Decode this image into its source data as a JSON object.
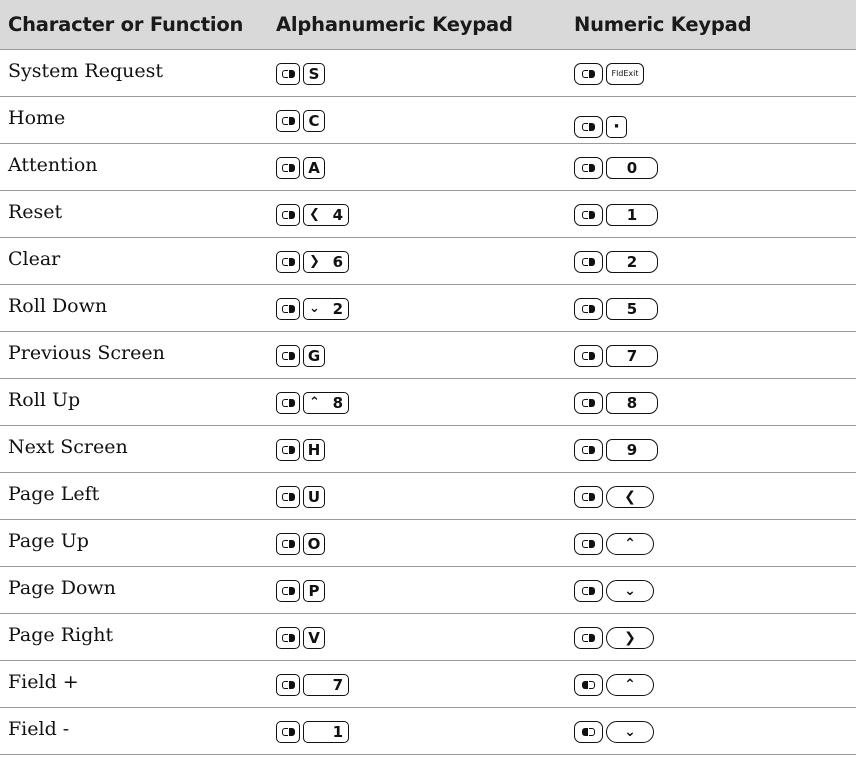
{
  "headers": [
    "Character or Function",
    "Alphanumeric Keypad",
    "Numeric Keypad"
  ],
  "icons": {
    "shift_key": "orange-shift-key-icon",
    "green_shift_key": "green-shift-key-icon"
  },
  "rows": [
    {
      "function": "System Request",
      "alpha": "S",
      "num": "FldExit"
    },
    {
      "function": "Home",
      "alpha": "C",
      "num": "·"
    },
    {
      "function": "Attention",
      "alpha": "A",
      "num": "0"
    },
    {
      "function": "Reset",
      "alpha": "4",
      "num": "1"
    },
    {
      "function": "Clear",
      "alpha": "6",
      "num": "2"
    },
    {
      "function": "Roll Down",
      "alpha": "2",
      "num": "5"
    },
    {
      "function": "Previous Screen",
      "alpha": "G",
      "num": "7"
    },
    {
      "function": "Roll Up",
      "alpha": "8",
      "num": "8"
    },
    {
      "function": "Next Screen",
      "alpha": "H",
      "num": "9"
    },
    {
      "function": "Page Left",
      "alpha": "U",
      "num": "<"
    },
    {
      "function": "Page Up",
      "alpha": "O",
      "num": "^"
    },
    {
      "function": "Page Down",
      "alpha": "P",
      "num": "v"
    },
    {
      "function": "Page Right",
      "alpha": "V",
      "num": ">"
    },
    {
      "function": "Field +",
      "alpha": "7",
      "num": "^"
    },
    {
      "function": "Field -",
      "alpha": "1",
      "num": "v"
    }
  ]
}
